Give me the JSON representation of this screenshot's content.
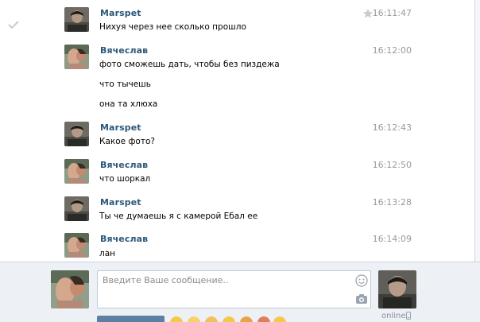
{
  "messages": [
    {
      "author": "Marspet",
      "time": "16:11:47",
      "lines": [
        "Нихуя через нее сколько прошло"
      ]
    },
    {
      "author": "Вячеслав",
      "time": "16:12:00",
      "lines": [
        "фото сможешь дать, чтобы без пиздежа",
        "что тычешь",
        "она та хлюха"
      ]
    },
    {
      "author": "Marspet",
      "time": "16:12:43",
      "lines": [
        "Какое фото?"
      ]
    },
    {
      "author": "Вячеслав",
      "time": "16:12:50",
      "lines": [
        "что шоркал"
      ]
    },
    {
      "author": "Marspet",
      "time": "16:13:28",
      "lines": [
        "Ты че думаешь я с камерой Ебал ее"
      ]
    },
    {
      "author": "Вячеслав",
      "time": "16:14:09",
      "lines": [
        "лан"
      ]
    }
  ],
  "composer": {
    "placeholder": "Введите Ваше сообщение.."
  },
  "peer": {
    "status": "online"
  },
  "colors": {
    "author": "#2b587a",
    "time": "#999999",
    "composer_bg": "#edf1f5",
    "send_button": "#5d7fa3"
  },
  "icons": [
    "check-icon",
    "star-icon",
    "smile-icon",
    "camera-icon",
    "phone-icon"
  ]
}
